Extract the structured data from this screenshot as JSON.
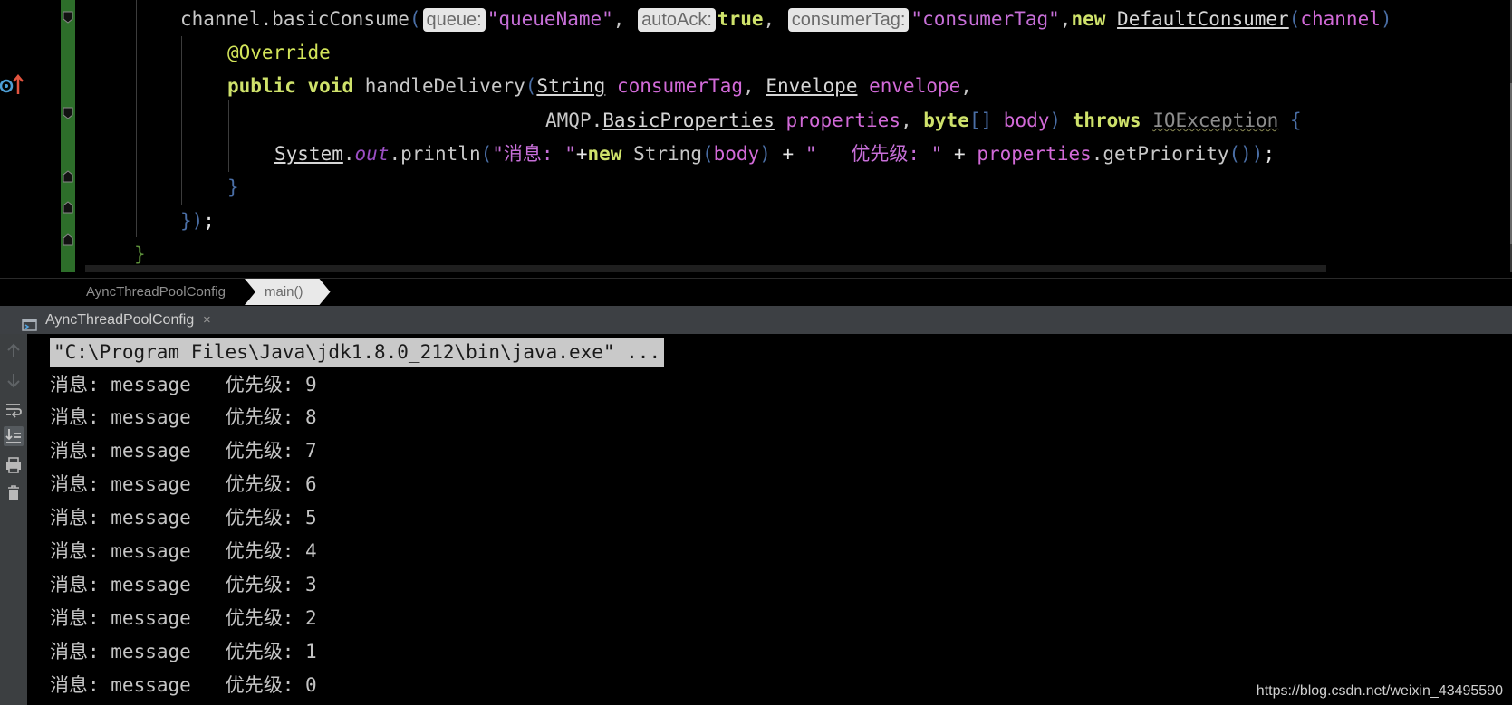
{
  "editor": {
    "line1": {
      "obj": "channel",
      "method": "basicConsume",
      "hint_queue": "queue:",
      "arg_queue": "\"queueName\"",
      "hint_autoack": "autoAck:",
      "arg_autoack": "true",
      "hint_tag": "consumerTag:",
      "arg_tag": "\"consumerTag\"",
      "kw_new": "new",
      "cls_consumer": "DefaultConsumer",
      "arg_channel": "channel"
    },
    "line2": {
      "annotation": "@Override"
    },
    "line3": {
      "kw_public": "public",
      "kw_void": "void",
      "method": "handleDelivery",
      "type_string": "String",
      "param_tag": "consumerTag",
      "type_envelope": "Envelope",
      "param_envelope": "envelope"
    },
    "line4": {
      "pkg": "AMQP.",
      "type_props": "BasicProperties",
      "param_props": "properties",
      "kw_byte": "byte",
      "brackets": "[]",
      "param_body": "body",
      "kw_throws": "throws",
      "type_ioex": "IOException",
      "brace": "{"
    },
    "line5": {
      "cls_system": "System",
      "field_out": "out",
      "method_println": "println",
      "str_msg": "\"消息: \"",
      "kw_new": "new",
      "type_string": "String",
      "arg_body": "body",
      "op_plus": "+",
      "str_priority": "\"   优先级: \"",
      "obj_props": "properties",
      "method_get": "getPriority",
      "end": "());"
    },
    "line6": {
      "brace": "}"
    },
    "line7": {
      "close": "});"
    },
    "line8": {
      "brace": "}"
    }
  },
  "breadcrumb": {
    "items": [
      "AyncThreadPoolConfig",
      "main()"
    ]
  },
  "run": {
    "tab_label": "AyncThreadPoolConfig",
    "tab_close": "×",
    "command": "\"C:\\Program Files\\Java\\jdk1.8.0_212\\bin\\java.exe\" ...",
    "lines": [
      "消息: message   优先级: 9",
      "消息: message   优先级: 8",
      "消息: message   优先级: 7",
      "消息: message   优先级: 6",
      "消息: message   优先级: 5",
      "消息: message   优先级: 4",
      "消息: message   优先级: 3",
      "消息: message   优先级: 2",
      "消息: message   优先级: 1",
      "消息: message   优先级: 0"
    ]
  },
  "watermark": "https://blog.csdn.net/weixin_43495590",
  "colors": {
    "keyword": "#cfe26b",
    "string": "#c76fd8",
    "gutter": "#2d6e2a",
    "console_bg": "#000000",
    "toolbar_bg": "#3c3f41"
  },
  "icons": [
    "method-override-icon",
    "fold-icon",
    "run-config-icon",
    "close-icon",
    "arrow-up-icon",
    "arrow-down-icon",
    "soft-wrap-icon",
    "scroll-to-end-icon",
    "print-icon",
    "trash-icon"
  ]
}
